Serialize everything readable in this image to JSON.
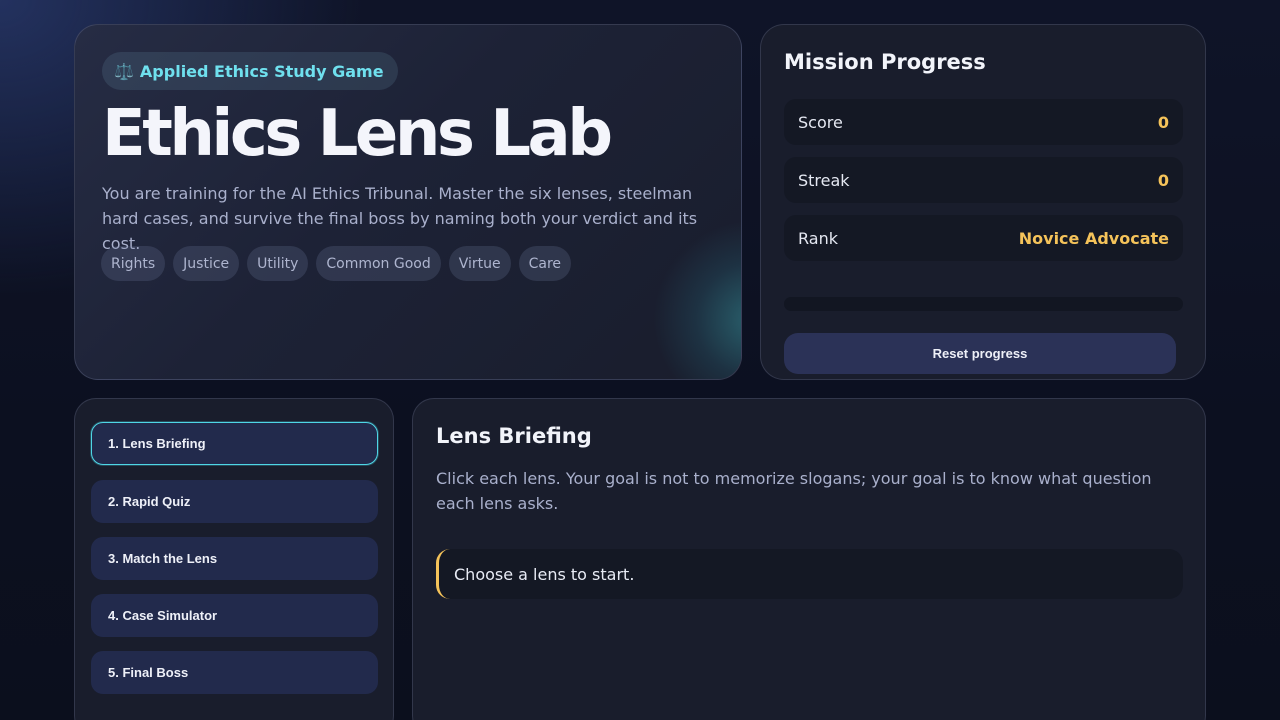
{
  "hero": {
    "badge_icon": "⚖️",
    "badge_label": "Applied Ethics Study Game",
    "title": "Ethics Lens Lab",
    "description": "You are training for the AI Ethics Tribunal. Master the six lenses, steelman hard cases, and survive the final boss by naming both your verdict and its cost.",
    "lenses": [
      "Rights",
      "Justice",
      "Utility",
      "Common Good",
      "Virtue",
      "Care"
    ]
  },
  "progress": {
    "title": "Mission Progress",
    "score_label": "Score",
    "score_value": "0",
    "streak_label": "Streak",
    "streak_value": "0",
    "rank_label": "Rank",
    "rank_value": "Novice Advocate",
    "progress_fraction": 0,
    "reset_label": "Reset progress"
  },
  "nav": {
    "items": [
      "1. Lens Briefing",
      "2. Rapid Quiz",
      "3. Match the Lens",
      "4. Case Simulator",
      "5. Final Boss"
    ],
    "active_index": 0
  },
  "main": {
    "title": "Lens Briefing",
    "description": "Click each lens. Your goal is not to memorize slogans; your goal is to know what question each lens asks.",
    "prompt": "Choose a lens to start."
  },
  "colors": {
    "accent_gold": "#f5c35a",
    "accent_cyan": "#4fd6e6"
  }
}
